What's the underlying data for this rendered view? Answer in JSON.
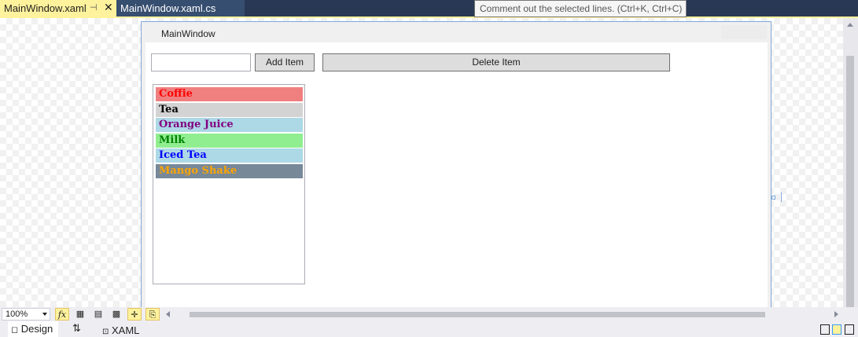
{
  "tabs": [
    {
      "label": "MainWindow.xaml",
      "pin_icon": "pin-icon",
      "close_glyph": "✕"
    },
    {
      "label": "MainWindow.xaml.cs"
    }
  ],
  "tooltip": "Comment out the selected lines. (Ctrl+K, Ctrl+C)",
  "window": {
    "title": "MainWindow"
  },
  "form": {
    "textbox_value": "",
    "add_button": "Add Item",
    "delete_button": "Delete Item"
  },
  "listbox": {
    "items": [
      {
        "label": "Coffie",
        "bg": "#f08080",
        "fg": "#ff0000"
      },
      {
        "label": "Tea",
        "bg": "#d3d3d3",
        "fg": "#000000"
      },
      {
        "label": "Orange Juice",
        "bg": "#add8e6",
        "fg": "#800080"
      },
      {
        "label": "Milk",
        "bg": "#90ee90",
        "fg": "#008000"
      },
      {
        "label": "Iced Tea",
        "bg": "#add8e6",
        "fg": "#0000ff"
      },
      {
        "label": "Mango Shake",
        "bg": "#778899",
        "fg": "#ffa500"
      }
    ]
  },
  "bottom_toolbar": {
    "zoom": "100%",
    "fx_label": "fx"
  },
  "view_tabs": {
    "design": "Design",
    "swap": "⇅",
    "xaml": "XAML"
  },
  "colors": {
    "accent_tab": "#fff29d",
    "tabstrip": "#293955",
    "selection": "#7fa8d8"
  }
}
